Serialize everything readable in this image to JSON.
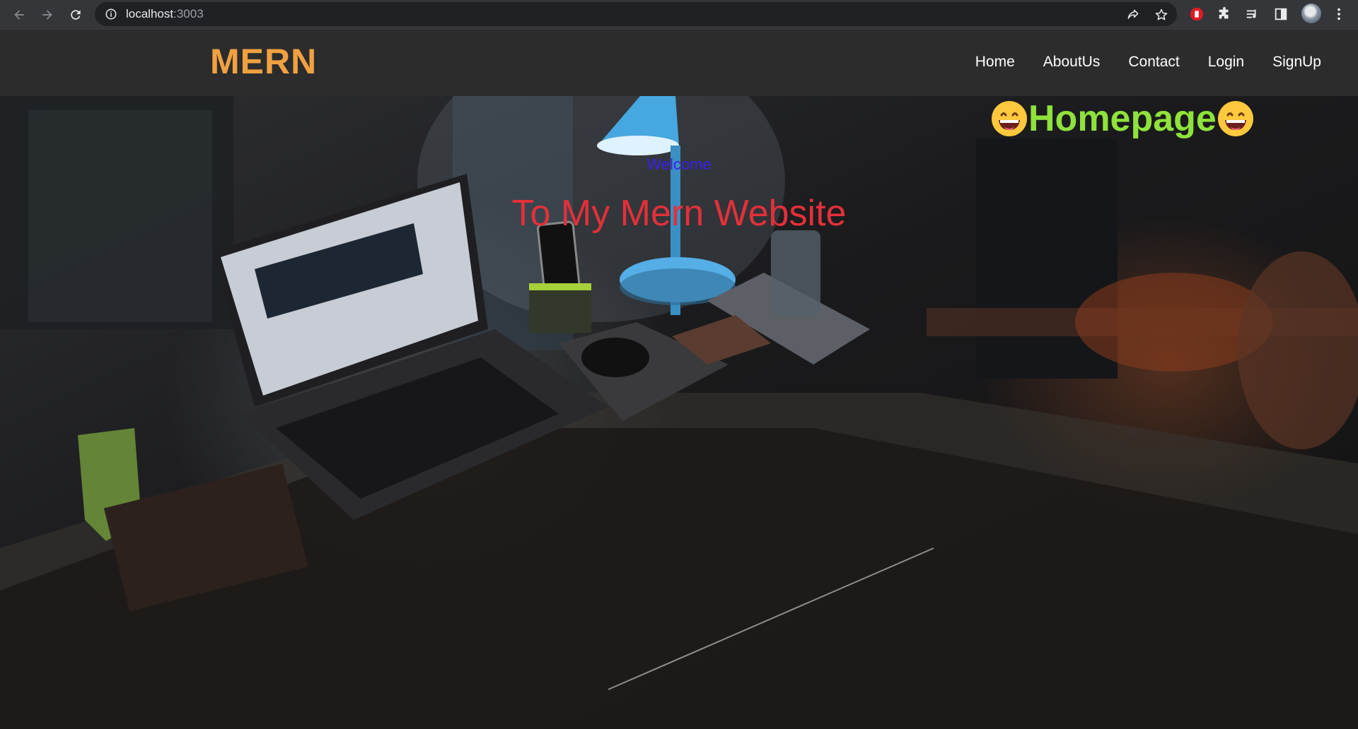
{
  "browser": {
    "url_host": "localhost",
    "url_port": ":3003",
    "icons": {
      "back": "back-arrow-icon",
      "forward": "forward-arrow-icon",
      "reload": "reload-icon",
      "info": "info-icon",
      "share": "share-icon",
      "bookmark": "star-icon",
      "extension_red": "red-extension-icon",
      "extensions": "puzzle-icon",
      "media": "media-queue-icon",
      "sidepanel": "side-panel-icon",
      "profile": "avatar",
      "menu": "kebab-menu-icon"
    }
  },
  "navbar": {
    "brand": "MERN",
    "links": [
      "Home",
      "AboutUs",
      "Contact",
      "Login",
      "SignUp"
    ]
  },
  "hero": {
    "homepage_label": "Homepage",
    "welcome": "Welcome",
    "tagline": "To My Mern Website",
    "emoji": "grinning-face-emoji"
  },
  "colors": {
    "brand": "#f0a140",
    "homepage": "#8fe23b",
    "welcome": "#3a1ff0",
    "tagline": "#e3303a",
    "navbar_bg": "#2c2c2d"
  }
}
